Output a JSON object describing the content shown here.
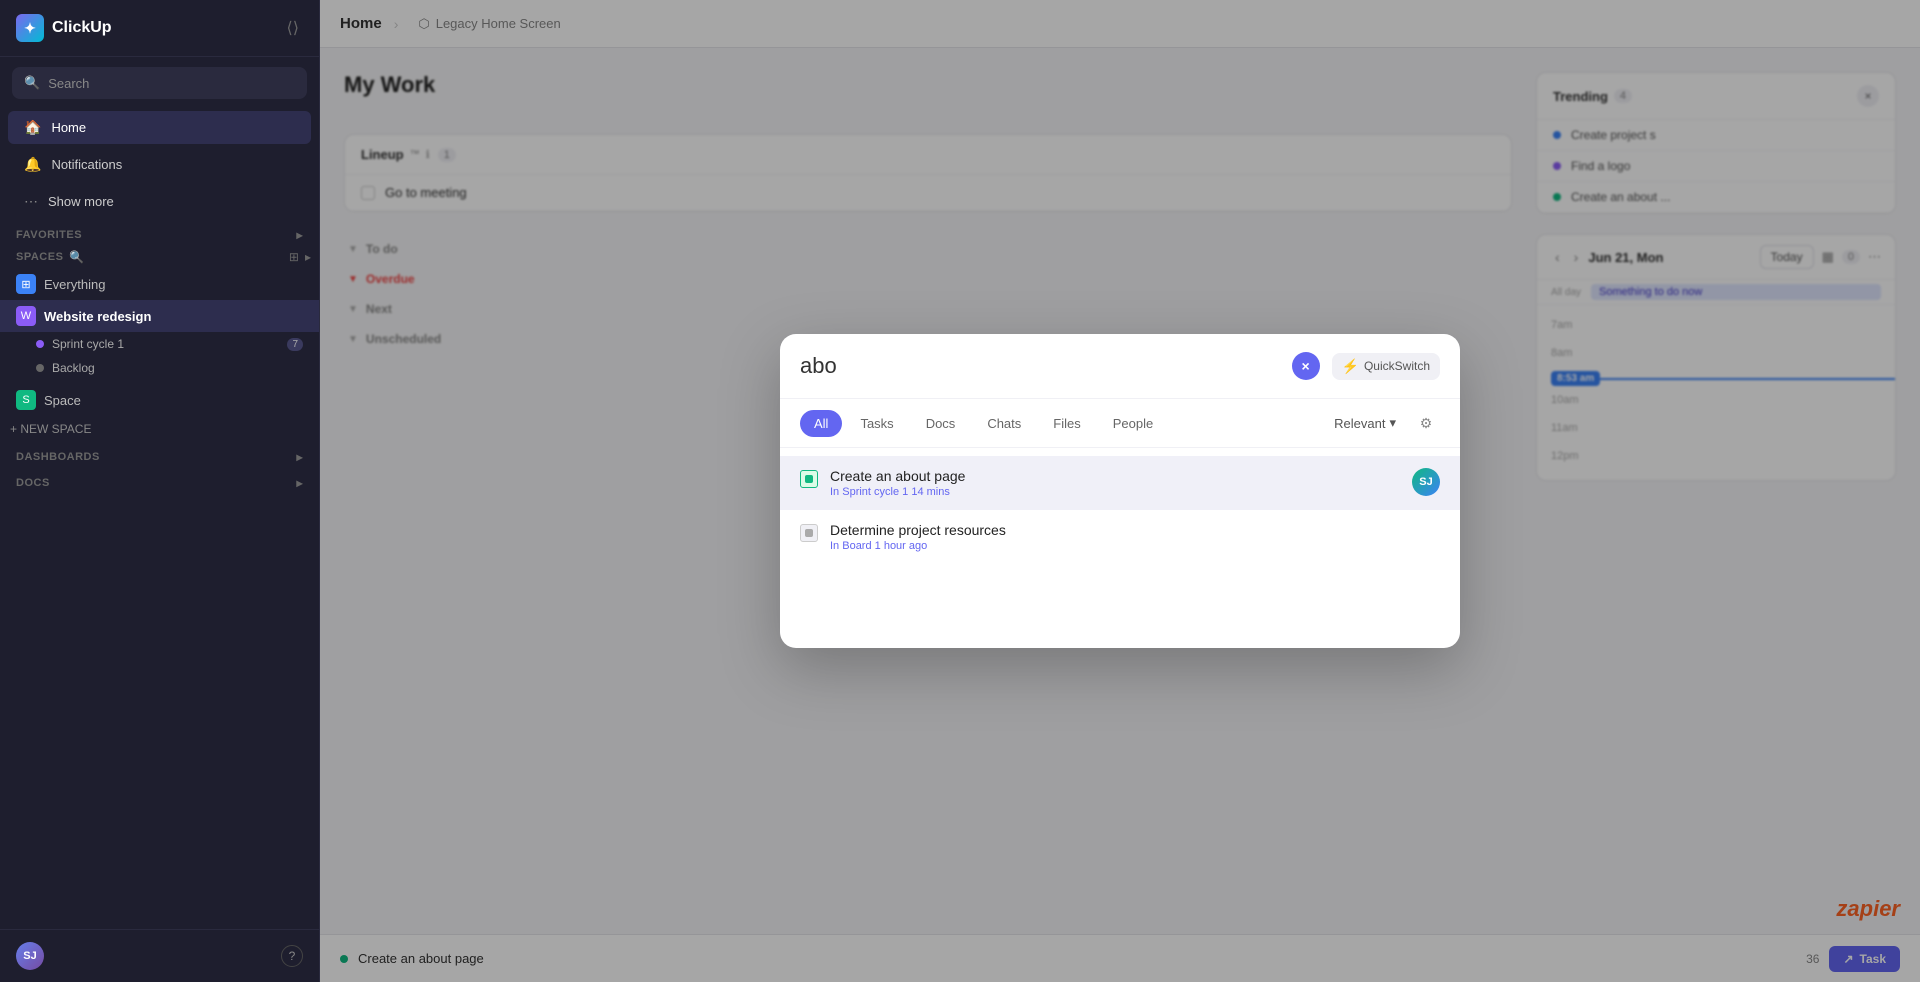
{
  "app": {
    "name": "ClickUp",
    "logo_text": "ClickUp"
  },
  "sidebar": {
    "search_placeholder": "Search",
    "nav_items": [
      {
        "id": "home",
        "label": "Home",
        "icon": "🏠",
        "active": true
      },
      {
        "id": "notifications",
        "label": "Notifications",
        "icon": "🔔",
        "active": false
      },
      {
        "id": "show_more",
        "label": "Show more",
        "icon": "⋯",
        "active": false
      }
    ],
    "sections": {
      "favorites": "FAVORITES",
      "spaces": "SPACES"
    },
    "spaces": [
      {
        "id": "everything",
        "label": "Everything",
        "icon": "◈",
        "color": "blue",
        "letter": "◈"
      },
      {
        "id": "website_redesign",
        "label": "Website redesign",
        "icon": "W",
        "color": "purple",
        "active": true
      }
    ],
    "sub_items": [
      {
        "id": "sprint_cycle_1",
        "label": "Sprint cycle 1",
        "badge": "7"
      },
      {
        "id": "backlog",
        "label": "Backlog"
      }
    ],
    "other_spaces": [
      {
        "id": "space",
        "label": "Space",
        "letter": "S"
      }
    ],
    "sections_bottom": {
      "dashboards": "DASHBOARDS",
      "docs": "DOCS"
    },
    "new_space_label": "+ NEW SPACE",
    "footer": {
      "user_initials": "SJ",
      "help_label": "?"
    }
  },
  "topbar": {
    "page_title": "Home",
    "breadcrumb_label": "Legacy Home Screen",
    "breadcrumb_icon": "⬡"
  },
  "lineup": {
    "title": "Lineup",
    "tm": "™",
    "badge": "1",
    "tasks": [
      {
        "id": "task1",
        "name": "Go to meeting",
        "checked": false
      }
    ]
  },
  "trending": {
    "title": "Trending",
    "badge": "4",
    "close_label": "×",
    "items": [
      {
        "id": "t1",
        "label": "Create project s",
        "color": "blue"
      },
      {
        "id": "t2",
        "label": "Find a logo",
        "color": "purple"
      },
      {
        "id": "t3",
        "label": "Create an about ...",
        "color": "green"
      }
    ]
  },
  "my_work": {
    "title": "My Work",
    "sections": [
      {
        "id": "to_do",
        "label": "To do",
        "color": "gray",
        "tasks": []
      },
      {
        "id": "overdue",
        "label": "Overdue",
        "color": "red",
        "tasks": []
      },
      {
        "id": "next",
        "label": "Next",
        "color": "blue",
        "tasks": []
      },
      {
        "id": "unscheduled",
        "label": "Unscheduled",
        "color": "gray",
        "tasks": []
      }
    ]
  },
  "calendar": {
    "date_label": "Jun 21, Mon",
    "nav_prev": "‹",
    "nav_next": "›",
    "today_label": "Today",
    "count_label": "0",
    "all_day_label": "All day",
    "all_day_event": "Something to do now",
    "current_time": "8:53 am",
    "time_slots": [
      {
        "id": "ts1",
        "time": "7am",
        "events": []
      },
      {
        "id": "ts2",
        "time": "8am",
        "events": []
      },
      {
        "id": "ts3",
        "time": "10am",
        "events": []
      },
      {
        "id": "ts4",
        "time": "11am",
        "events": []
      },
      {
        "id": "ts5",
        "time": "12pm",
        "events": []
      }
    ]
  },
  "bottom_bar": {
    "task_dot_color": "green",
    "task_name": "Create an about page",
    "task_btn_label": "Task",
    "task_btn_icon": "↗",
    "icon_count": "36"
  },
  "modal": {
    "search_query": "abo",
    "clear_btn": "×",
    "quickswitch_label": "QuickSwitch",
    "quickswitch_icon": "⚡",
    "filter_tabs": [
      {
        "id": "all",
        "label": "All",
        "active": true
      },
      {
        "id": "tasks",
        "label": "Tasks",
        "active": false
      },
      {
        "id": "docs",
        "label": "Docs",
        "active": false
      },
      {
        "id": "chats",
        "label": "Chats",
        "active": false
      },
      {
        "id": "files",
        "label": "Files",
        "active": false
      },
      {
        "id": "people",
        "label": "People",
        "active": false
      }
    ],
    "sort_label": "Relevant",
    "sort_icon": "▾",
    "settings_icon": "⚙",
    "results": [
      {
        "id": "r1",
        "title": "Create an about page",
        "meta_prefix": "In",
        "meta_location": "Sprint cycle 1",
        "meta_time": "14 mins",
        "icon_color": "green",
        "has_avatar": true,
        "avatar_initials": "SJ",
        "highlighted": true
      },
      {
        "id": "r2",
        "title": "Determine project resources",
        "meta_prefix": "In",
        "meta_location": "Board",
        "meta_time": "1 hour ago",
        "icon_color": "gray",
        "has_avatar": false,
        "highlighted": false
      }
    ]
  },
  "zapier": {
    "label": "zapier"
  }
}
